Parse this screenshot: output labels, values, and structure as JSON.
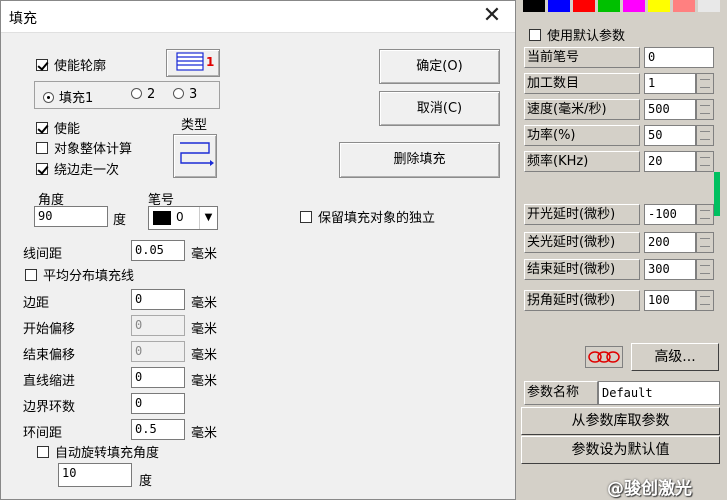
{
  "dialog": {
    "title": "填充",
    "close_glyph": "✕",
    "enable_outline_label": "使能轮廓",
    "fill_radios": [
      {
        "label": "填充1",
        "selected": true
      },
      {
        "label": "2",
        "selected": false
      },
      {
        "label": "3",
        "selected": false
      }
    ],
    "enable_label": "使能",
    "whole_calc_label": "对象整体计算",
    "edge_once_label": "绕边走一次",
    "type_label": "类型",
    "angle_label": "角度",
    "angle_value": "90",
    "angle_unit": "度",
    "pen_label": "笔号",
    "pen_value": "0",
    "line_spacing_label": "线间距",
    "line_spacing_value": "0.05",
    "mm_unit": "毫米",
    "avg_distribute_label": "平均分布填充线",
    "margin_label": "边距",
    "margin_value": "0",
    "start_offset_label": "开始偏移",
    "start_offset_value": "0",
    "end_offset_label": "结束偏移",
    "end_offset_value": "0",
    "line_indent_label": "直线缩进",
    "line_indent_value": "0",
    "loop_count_label": "边界环数",
    "loop_count_value": "0",
    "loop_spacing_label": "环间距",
    "loop_spacing_value": "0.5",
    "auto_rotate_label": "自动旋转填充角度",
    "rotate_value": "10",
    "rotate_unit": "度",
    "ok_button": "确定(O)",
    "cancel_button": "取消(C)",
    "delete_fill_button": "删除填充",
    "keep_independent_label": "保留填充对象的独立",
    "pen_color": "#000000"
  },
  "panel": {
    "swatch_colors": [
      "#000000",
      "#0000ff",
      "#ff0000",
      "#00c000",
      "#ff00ff",
      "#ffff00",
      "#ff8080",
      "#e8e8e8"
    ],
    "use_default_label": "使用默认参数",
    "current_pen_label": "当前笔号",
    "current_pen_value": "0",
    "rows": [
      {
        "label": "加工数目",
        "value": "1"
      },
      {
        "label": "速度(毫米/秒)",
        "value": "500"
      },
      {
        "label": "功率(%)",
        "value": "50"
      },
      {
        "label": "频率(KHz)",
        "value": "20"
      }
    ],
    "delay_rows": [
      {
        "label": "开光延时(微秒)",
        "value": "-100"
      },
      {
        "label": "关光延时(微秒)",
        "value": "200"
      },
      {
        "label": "结束延时(微秒)",
        "value": "300"
      },
      {
        "label": "拐角延时(微秒)",
        "value": "100"
      }
    ],
    "advanced_button": "高级...",
    "param_name_label": "参数名称",
    "param_name_value": "Default",
    "from_library_button": "从参数库取参数",
    "set_default_button": "参数设为默认值",
    "watermark": "@骏创激光"
  }
}
